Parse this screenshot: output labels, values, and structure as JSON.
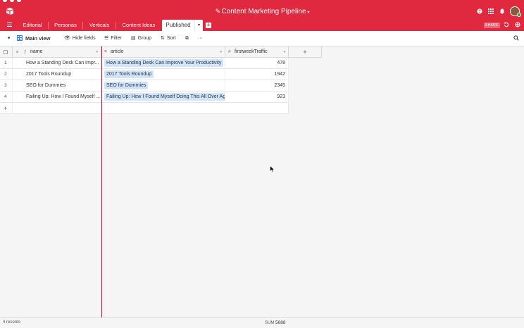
{
  "header": {
    "title": "Content Marketing Pipeline",
    "pencil_icon": "pencil-icon",
    "caret": "▾",
    "icons": [
      "help-icon",
      "apps-grid-icon",
      "bell-icon",
      "user-avatar"
    ]
  },
  "tabs": [
    {
      "label": "Editorial"
    },
    {
      "label": "Personas"
    },
    {
      "label": "Verticals"
    },
    {
      "label": "Content Ideas"
    },
    {
      "label": "Published"
    }
  ],
  "share_label": "SHARE",
  "toolbar": {
    "view_name": "Main view",
    "hide_fields": "Hide fields",
    "filter": "Filter",
    "group": "Group",
    "sort": "Sort",
    "more": "···"
  },
  "table": {
    "columns": [
      {
        "name": "name",
        "type_icon": "ƒ"
      },
      {
        "name": "article",
        "type_icon": "≡"
      },
      {
        "name": "firstweekTraffic",
        "type_icon": "#"
      }
    ],
    "rows": [
      {
        "num": "1",
        "name": "How a Standing Desk Can Impr...",
        "article": "How a Standing Desk Can Improve Your Productivity",
        "traffic": "478"
      },
      {
        "num": "2",
        "name": "2017 Tools Roundup",
        "article": "2017 Tools Roundup",
        "traffic": "1942"
      },
      {
        "num": "3",
        "name": "SEO for Dummies",
        "article": "SEO for Dummies",
        "traffic": "2345"
      },
      {
        "num": "4",
        "name": "Failing Up: How I Found Myself ...",
        "article": "Failing Up: How I Found Myself Doing This All Over Aga",
        "traffic": "923"
      }
    ]
  },
  "footer": {
    "records": "4 records",
    "sum_label": "SUM",
    "sum_value": "5688"
  },
  "colors": {
    "brand": "#e0283f",
    "chip": "#d0e4fc",
    "accent_blue": "#2d7ff9"
  }
}
